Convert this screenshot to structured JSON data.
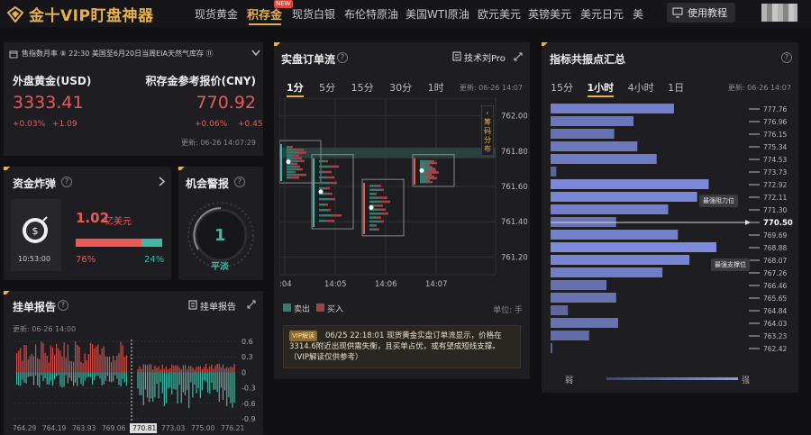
{
  "app": {
    "title": "金十VIP盯盘神器",
    "nav": [
      "现货黄金",
      "积存金",
      "现货白银",
      "布伦特原油",
      "美国WTI原油",
      "欧元美元",
      "英镑美元",
      "美元日元",
      "美"
    ],
    "new_badge": "NEW",
    "tutorial_label": "使用教程"
  },
  "ticker": {
    "text": "售指数月率 ⑧ 22:30 美国至6月20日当周EIA天然气库存 ⑪"
  },
  "quote": {
    "left_title": "外盘黄金(USD)",
    "left_price": "3333.41",
    "left_pct": "+0.03%",
    "left_chg": "+1.09",
    "right_title": "积存金参考报价(CNY)",
    "right_price": "770.92",
    "right_pct": "+0.06%",
    "right_chg": "+0.45",
    "updated": "更新:  06-26 14:07:29"
  },
  "fund": {
    "title": "资金炸弹",
    "amount": "1.02",
    "unit": "亿美元",
    "time": "10:53:00",
    "sell_pct": "76%",
    "buy_pct": "24%",
    "ratio": 0.76
  },
  "alert": {
    "title": "机会警报",
    "value": "1",
    "label": "平淡"
  },
  "order_report": {
    "title": "挂单报告",
    "link": "挂单报告",
    "updated": "更新:  06-26 14:00",
    "y_ticks": [
      "0.6",
      "0.3",
      "0",
      "-0.3",
      "-0.6",
      "-0.9"
    ],
    "x_ticks": [
      "764.29",
      "764.19",
      "763.93",
      "769.06",
      "770.81",
      "773.03",
      "775.00",
      "776.21"
    ]
  },
  "order_flow": {
    "title": "实盘订单流",
    "link": "技术刘Pro",
    "tabs": [
      "1分",
      "5分",
      "15分",
      "30分",
      "1时"
    ],
    "active_tab": "1分",
    "updated": "更新:  06-26 14:07",
    "side_label": "筹码分布",
    "y_ticks": [
      "762.00",
      "761.80",
      "761.60",
      "761.40",
      "761.20"
    ],
    "x_ticks": [
      ":04",
      "14:05",
      "14:06",
      "14:07"
    ],
    "legend_sell": "卖出",
    "legend_buy": "买入",
    "unit": "单位:  手",
    "vip_badge": "VIP解读",
    "vip_text": "06/25 22:18:01 现货黄金实盘订单流显示，价格在3314.6附近出现供需失衡，且买单占优，或有望成短线支撑。（VIP解读仅供参考）"
  },
  "resonance": {
    "title": "指标共振点汇总",
    "tabs": [
      "15分",
      "1小时",
      "4小时",
      "1日"
    ],
    "active_tab": "1小时",
    "updated": "更新:  06-26 14:07",
    "levels": [
      "777.76",
      "776.96",
      "776.15",
      "775.34",
      "774.53",
      "773.73",
      "772.92",
      "772.11",
      "771.30",
      "770.50",
      "769.69",
      "768.88",
      "768.07",
      "767.26",
      "766.46",
      "765.65",
      "764.84",
      "764.03",
      "763.23",
      "762.42"
    ],
    "current": "770.50",
    "strengths": [
      0.64,
      0.43,
      0.33,
      0.45,
      0.55,
      0.03,
      0.82,
      0.76,
      0.61,
      0.34,
      0.66,
      0.86,
      0.72,
      0.58,
      0.29,
      0.34,
      0.09,
      0.35,
      0.2,
      0.0
    ],
    "tooltip_resist": "最强阻力位",
    "tooltip_support": "最强支撑位",
    "weak": "弱",
    "strong": "强"
  },
  "colors": {
    "accent": "#e7b04a",
    "up": "#ea5a55",
    "down": "#3fb8a5",
    "bar": "#5a6ab8"
  }
}
